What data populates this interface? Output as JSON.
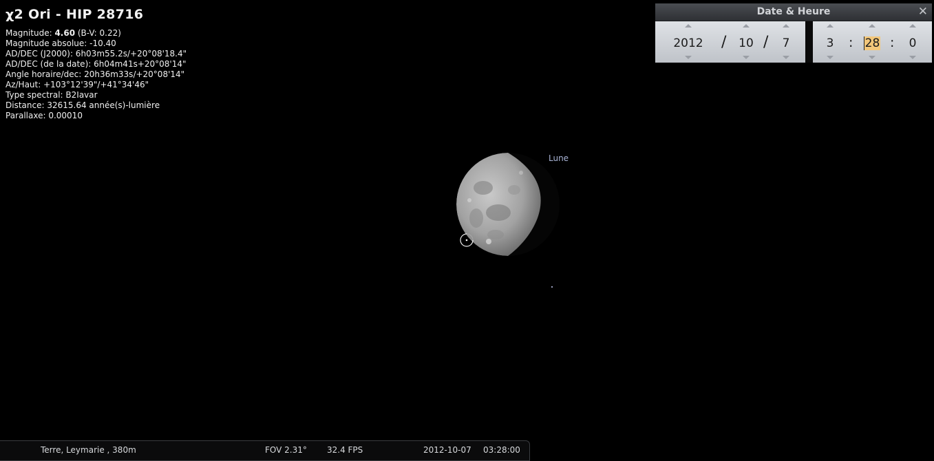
{
  "object": {
    "title": "χ2 Ori - HIP 28716",
    "magnitude_label": "Magnitude: ",
    "magnitude_value": "4.60",
    "magnitude_bv": " (B-V: 0.22)",
    "lines": [
      "Magnitude absolue: -10.40",
      "AD/DEC (J2000): 6h03m55.2s/+20°08'18.4\"",
      "AD/DEC (de la date): 6h04m41s+20°08'14\"",
      "Angle horaire/dec: 20h36m33s/+20°08'14\"",
      "Az/Haut: +103°12'39\"/+41°34'46\"",
      "Type spectral: B2Iavar",
      "Distance: 32615.64 année(s)-lumière",
      "Parallaxe: 0.00010"
    ]
  },
  "sky": {
    "moon_label": "Lune"
  },
  "datetime_window": {
    "title": "Date & Heure",
    "close_icon": "close-icon",
    "year": "2012",
    "month": "10",
    "day": "7",
    "hour": "3",
    "minute": "28",
    "second": "0",
    "date_separator": "/",
    "time_separator": ":"
  },
  "statusbar": {
    "location": "Terre, Leymarie , 380m",
    "fov": "FOV 2.31°",
    "fps": "32.4 FPS",
    "date": "2012-10-07",
    "time": "03:28:00"
  },
  "colors": {
    "background": "#000000",
    "moon_label": "#a9b4d6",
    "spin_highlight": "#f3c77a"
  }
}
